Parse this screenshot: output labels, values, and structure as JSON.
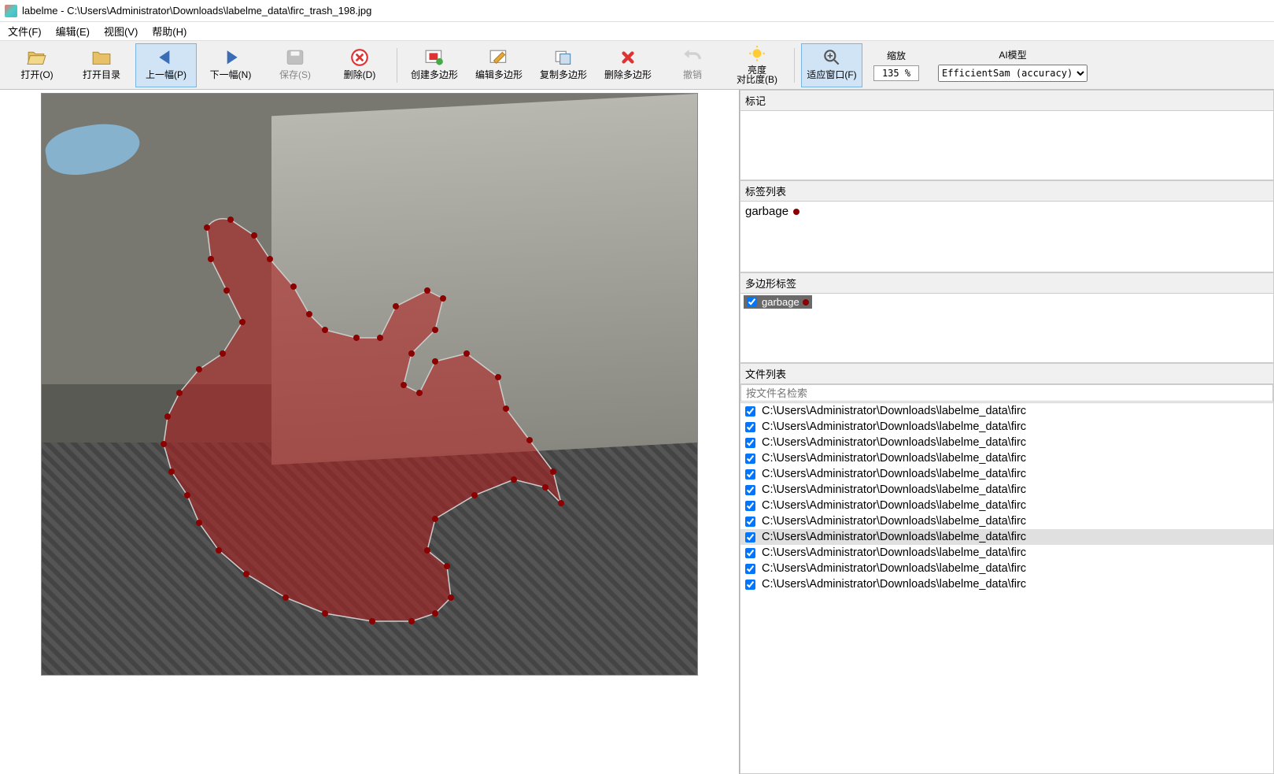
{
  "window": {
    "app_name": "labelme",
    "title_path": "C:\\Users\\Administrator\\Downloads\\labelme_data\\firc_trash_198.jpg"
  },
  "menu": {
    "file": "文件(F)",
    "edit": "编辑(E)",
    "view": "视图(V)",
    "help": "帮助(H)"
  },
  "toolbar": {
    "open": "打开(O)",
    "open_dir": "打开目录",
    "prev": "上一幅(P)",
    "next": "下一幅(N)",
    "save": "保存(S)",
    "delete": "删除(D)",
    "create_poly": "创建多边形",
    "edit_poly": "编辑多边形",
    "copy_poly": "复制多边形",
    "delete_poly": "删除多边形",
    "undo": "撤销",
    "brightness": "亮度",
    "contrast": "对比度(B)",
    "fit_window": "适应窗口(F)",
    "zoom_label": "缩放",
    "zoom_value": "135 %",
    "ai_label": "AI模型",
    "ai_value": "EfficientSam (accuracy)"
  },
  "panels": {
    "flags_title": "标记",
    "label_list_title": "标签列表",
    "label_item": "garbage",
    "poly_labels_title": "多边形标签",
    "poly_item": "garbage",
    "file_list_title": "文件列表",
    "search_placeholder": "按文件名检索"
  },
  "files": {
    "path_prefix": "C:\\Users\\Administrator\\Downloads\\labelme_data\\firc",
    "count": 12,
    "selected_index": 8
  }
}
